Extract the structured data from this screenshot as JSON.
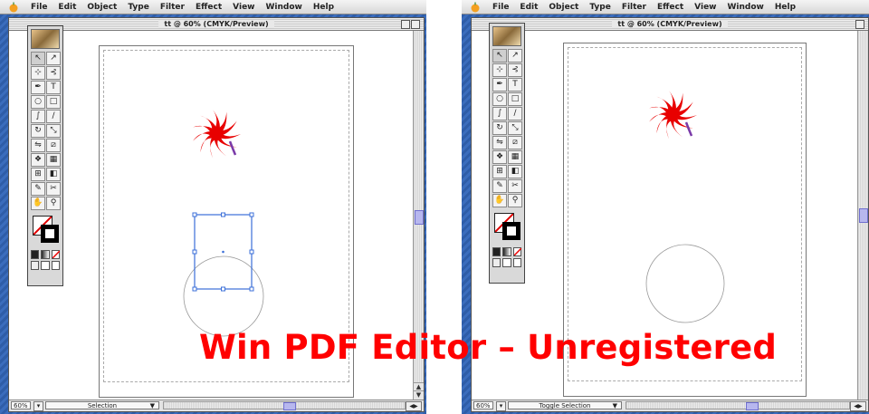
{
  "menubar": {
    "items": [
      "File",
      "Edit",
      "Object",
      "Type",
      "Filter",
      "Effect",
      "View",
      "Window",
      "Help"
    ]
  },
  "left_window": {
    "title": "tt @ 60% (CMYK/Preview)",
    "zoom": "60%",
    "status_mode": "Selection"
  },
  "right_window": {
    "title": "tt @ 60% (CMYK/Preview)",
    "zoom": "60%",
    "status_mode": "Toggle Selection"
  },
  "toolbox": {
    "tools": [
      "selection-tool",
      "direct-selection-tool",
      "group-selection-tool",
      "lasso-tool",
      "pen-tool",
      "type-tool",
      "ellipse-tool",
      "rectangle-tool",
      "paintbrush-tool",
      "pencil-tool",
      "rotate-tool",
      "scale-tool",
      "reflect-tool",
      "shear-tool",
      "symbol-sprayer-tool",
      "graph-tool",
      "mesh-tool",
      "gradient-tool",
      "eyedropper-tool",
      "scissors-tool",
      "hand-tool",
      "zoom-tool"
    ],
    "glyphs": [
      "↖",
      "↗",
      "⊹",
      "⊰",
      "✒",
      "T",
      "○",
      "□",
      "∫",
      "∕",
      "↻",
      "⤡",
      "⇋",
      "⧄",
      "❖",
      "▦",
      "⊞",
      "◧",
      "✎",
      "✂",
      "✋",
      "⚲"
    ]
  },
  "colors": {
    "accent_red": "#ff0000",
    "starburst_red": "#e80000",
    "stroke_purple": "#7a3aa8",
    "selection_blue": "#3b6fd8",
    "desktop_blue": "#3a6ab8"
  },
  "watermark": "Win PDF Editor – Unregistered"
}
